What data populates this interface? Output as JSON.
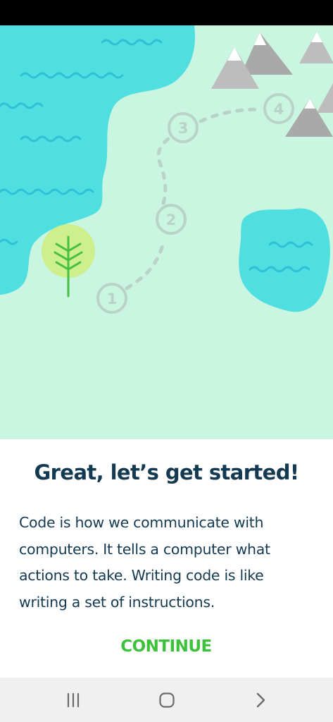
{
  "onboarding": {
    "title": "Great, let’s get started!",
    "description": "Code is how we communicate with computers. It tells a computer what actions to take. Writing code is like writing a set of instructions.",
    "continue_label": "CONTINUE"
  },
  "map": {
    "steps": [
      "1",
      "2",
      "3",
      "4"
    ],
    "icons": [
      "tree-icon",
      "mountain-icon",
      "wave-icon"
    ]
  },
  "navigation": {
    "icons": [
      "recent-apps-icon",
      "home-icon",
      "back-icon"
    ]
  },
  "colors": {
    "background": "#c9f5e1",
    "water": "#4fdfe0",
    "title_text": "#143a52",
    "accent": "#3cc13b"
  }
}
